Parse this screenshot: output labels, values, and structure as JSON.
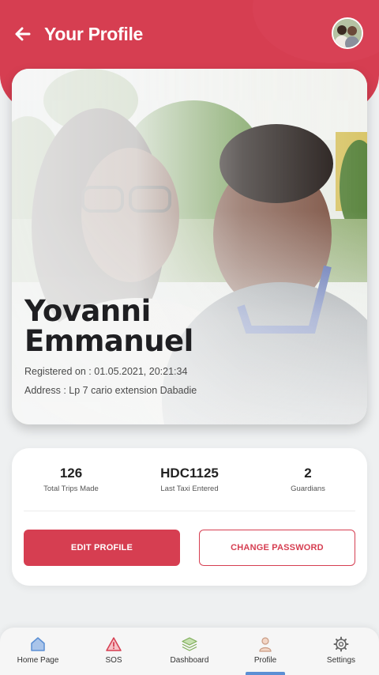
{
  "header": {
    "title": "Your Profile",
    "back_icon": "back-arrow-icon",
    "accent_color": "#d63e51"
  },
  "profile": {
    "first_name": "Yovanni",
    "last_name": "Emmanuel",
    "registered": "Registered on : 01.05.2021, 20:21:34",
    "address": "Address : Lp 7 cario extension Dabadie"
  },
  "stats": [
    {
      "value": "126",
      "label": "Total Trips Made"
    },
    {
      "value": "HDC1125",
      "label": "Last Taxi Entered"
    },
    {
      "value": "2",
      "label": "Guardians"
    }
  ],
  "buttons": {
    "edit_profile": "EDIT PROFILE",
    "change_password": "CHANGE PASSWORD"
  },
  "nav": [
    {
      "label": "Home Page",
      "icon": "home-icon"
    },
    {
      "label": "SOS",
      "icon": "warning-icon"
    },
    {
      "label": "Dashboard",
      "icon": "layers-icon"
    },
    {
      "label": "Profile",
      "icon": "user-icon",
      "active": true
    },
    {
      "label": "Settings",
      "icon": "gear-icon"
    }
  ]
}
